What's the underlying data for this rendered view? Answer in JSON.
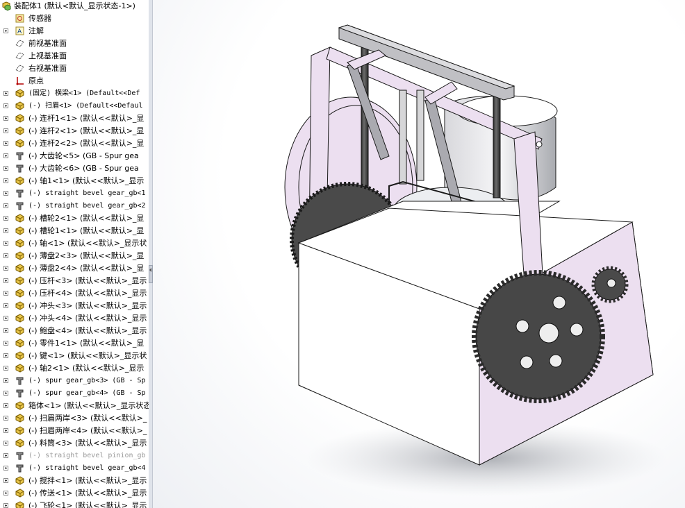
{
  "tree": {
    "root_label": "装配体1  (默认<默认_显示状态-1>)",
    "fixed_items": [
      {
        "label": "传感器",
        "icon": "sensor-icon"
      },
      {
        "label": "注解",
        "icon": "annotation-icon"
      },
      {
        "label": "前视基准面",
        "icon": "plane-icon"
      },
      {
        "label": "上视基准面",
        "icon": "plane-icon"
      },
      {
        "label": "右视基准面",
        "icon": "plane-icon"
      },
      {
        "label": "原点",
        "icon": "origin-icon"
      }
    ],
    "components": [
      {
        "label": "(固定) 横梁<1> (Default<<Def",
        "icon": "part",
        "mono": true
      },
      {
        "label": "(-) 扫眉<1> (Default<<Defaul",
        "icon": "part",
        "mono": true
      },
      {
        "label": "(-) 连杆1<1> (默认<<默认>_显",
        "icon": "part"
      },
      {
        "label": "(-) 连杆2<1> (默认<<默认>_显",
        "icon": "part"
      },
      {
        "label": "(-) 连杆2<2> (默认<<默认>_显",
        "icon": "part"
      },
      {
        "label": "(-) 大齿轮<5> (GB - Spur gea",
        "icon": "toolbox"
      },
      {
        "label": "(-) 大齿轮<6> (GB - Spur gea",
        "icon": "toolbox"
      },
      {
        "label": "(-) 轴1<1> (默认<<默认>_显示",
        "icon": "part"
      },
      {
        "label": "(-) straight bevel gear_gb<1",
        "icon": "toolbox",
        "mono": true
      },
      {
        "label": "(-) straight bevel gear_gb<2",
        "icon": "toolbox",
        "mono": true
      },
      {
        "label": "(-) 槽轮2<1> (默认<<默认>_显",
        "icon": "part"
      },
      {
        "label": "(-) 槽轮1<1> (默认<<默认>_显",
        "icon": "part"
      },
      {
        "label": "(-) 轴<1> (默认<<默认>_显示状",
        "icon": "part"
      },
      {
        "label": "(-) 薄盘2<3> (默认<<默认>_显",
        "icon": "part"
      },
      {
        "label": "(-) 薄盘2<4> (默认<<默认>_显",
        "icon": "part"
      },
      {
        "label": "(-) 压杆<3> (默认<<默认>_显示",
        "icon": "part"
      },
      {
        "label": "(-) 压杆<4> (默认<<默认>_显示",
        "icon": "part"
      },
      {
        "label": "(-) 冲头<3> (默认<<默认>_显示",
        "icon": "part"
      },
      {
        "label": "(-) 冲头<4> (默认<<默认>_显示",
        "icon": "part"
      },
      {
        "label": "(-) 鲍盘<4> (默认<<默认>_显示",
        "icon": "part"
      },
      {
        "label": "(-) 零件1<1> (默认<<默认>_显",
        "icon": "part"
      },
      {
        "label": "(-) 键<1> (默认<<默认>_显示状",
        "icon": "part"
      },
      {
        "label": "(-) 轴2<1> (默认<<默认>_显示",
        "icon": "part"
      },
      {
        "label": "(-) spur gear_gb<3> (GB - Sp",
        "icon": "toolbox",
        "mono": true
      },
      {
        "label": "(-) spur gear_gb<4> (GB - Sp",
        "icon": "toolbox",
        "mono": true
      },
      {
        "label": "箱体<1> (默认<<默认>_显示状态",
        "icon": "part"
      },
      {
        "label": "(-) 扫眉两岸<3> (默认<<默认>_",
        "icon": "part"
      },
      {
        "label": "(-) 扫眉两岸<4> (默认<<默认>_",
        "icon": "part"
      },
      {
        "label": "(-) 料筒<3> (默认<<默认>_显示",
        "icon": "part"
      },
      {
        "label": "(-) straight bevel pinion_gb",
        "icon": "toolbox",
        "mono": true,
        "dim": true
      },
      {
        "label": "(-) straight bevel gear_gb<4",
        "icon": "toolbox",
        "mono": true
      },
      {
        "label": "(-) 搅拌<1> (默认<<默认>_显示",
        "icon": "part"
      },
      {
        "label": "(-) 传送<1> (默认<<默认>_显示",
        "icon": "part"
      },
      {
        "label": "(-) 飞轮<1> (默认<<默认>_显示",
        "icon": "part"
      }
    ]
  },
  "colors": {
    "body_pink": "#ecdff0",
    "body_white": "#ffffff",
    "gear_dark": "#3e3e3e",
    "metal_gray": "#9ea0a6",
    "outline": "#1a1a1a"
  }
}
